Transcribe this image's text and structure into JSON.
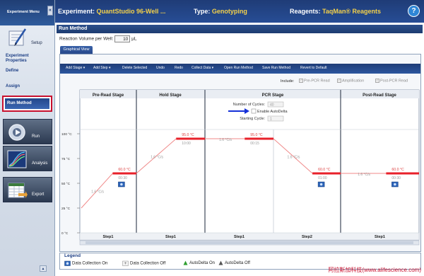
{
  "sidebar": {
    "header_label": "Experiment Menu",
    "collapse_symbol": "«",
    "setup_label": "Setup",
    "links": [
      {
        "label": "Experiment Properties"
      },
      {
        "label": "Define"
      },
      {
        "label": "Assign"
      }
    ],
    "run_method_label": "Run Method",
    "buttons": [
      {
        "label": "Run"
      },
      {
        "label": "Analysis"
      },
      {
        "label": "Export"
      }
    ],
    "up_symbol": "▲"
  },
  "header": {
    "experiment_label": "Experiment:",
    "experiment_value": "QuantStudio 96-Well ...",
    "type_label": "Type:",
    "type_value": "Genotyping",
    "reagents_label": "Reagents:",
    "reagents_value": "TaqMan® Reagents",
    "help_symbol": "?"
  },
  "panel_title": "Run Method",
  "reaction": {
    "label": "Reaction Volume per Well:",
    "value": "10",
    "unit": "µL"
  },
  "tab": "Graphical View",
  "toolbar": [
    {
      "label": "Add Stage ▾"
    },
    {
      "label": "Add Step ▾"
    },
    {
      "label": "Delete Selected"
    },
    {
      "label": "Undo"
    },
    {
      "label": "Redo"
    },
    {
      "label": "Collect Data ▾"
    },
    {
      "label": "Open Run Method"
    },
    {
      "label": "Save Run Method"
    },
    {
      "label": "Revert to Default"
    }
  ],
  "include": {
    "label": "Include:",
    "options": [
      {
        "label": "Pre-PCR Read",
        "checked": true
      },
      {
        "label": "Amplification",
        "checked": true
      },
      {
        "label": "Post-PCR Read",
        "checked": true
      }
    ]
  },
  "stages": [
    {
      "name": "Pre-Read Stage",
      "steps": [
        {
          "label": "Step1",
          "temp": "60.0 °C",
          "time": "00:30",
          "ramp": "1.6 °C/s",
          "temp_value": 60
        }
      ]
    },
    {
      "name": "Hold Stage",
      "steps": [
        {
          "label": "Step1",
          "temp": "95.0 °C",
          "time": "10:00",
          "ramp": "1.6 °C/s",
          "temp_value": 95
        }
      ]
    },
    {
      "name": "PCR Stage",
      "cycles_label": "Number of Cycles:",
      "cycles_value": "40",
      "auto_delta_label": "Enable AutoDelta",
      "start_cycle_label": "Starting Cycle:",
      "start_cycle_value": "1",
      "steps": [
        {
          "label": "Step1",
          "temp": "95.0 °C",
          "time": "00:15",
          "ramp": "1.6 °C/s",
          "temp_value": 95
        },
        {
          "label": "Step2",
          "temp": "60.0 °C",
          "time": "01:00",
          "ramp": "1.6 °C/s",
          "temp_value": 60
        }
      ]
    },
    {
      "name": "Post-Read Stage",
      "steps": [
        {
          "label": "Step1",
          "temp": "60.0 °C",
          "time": "00:30",
          "ramp": "1.6 °C/s",
          "temp_value": 60
        }
      ]
    }
  ],
  "y_axis": {
    "ticks": [
      "100 °C",
      "75 °C",
      "50 °C",
      "25 °C",
      "0 °C"
    ],
    "max": 100
  },
  "legend": {
    "title": "Legend",
    "items": [
      {
        "label": "Data Collection On"
      },
      {
        "label": "Data Collection Off"
      },
      {
        "label": "AutoDelta On"
      },
      {
        "label": "AutoDelta Off"
      }
    ]
  },
  "watermark": "阿拉斯加科技(www.alifescience.com)",
  "colors": {
    "accent": "#1f3c77",
    "highlight": "#c8102e",
    "temp_line": "#e8202a",
    "value_yellow": "#f4d14a"
  }
}
